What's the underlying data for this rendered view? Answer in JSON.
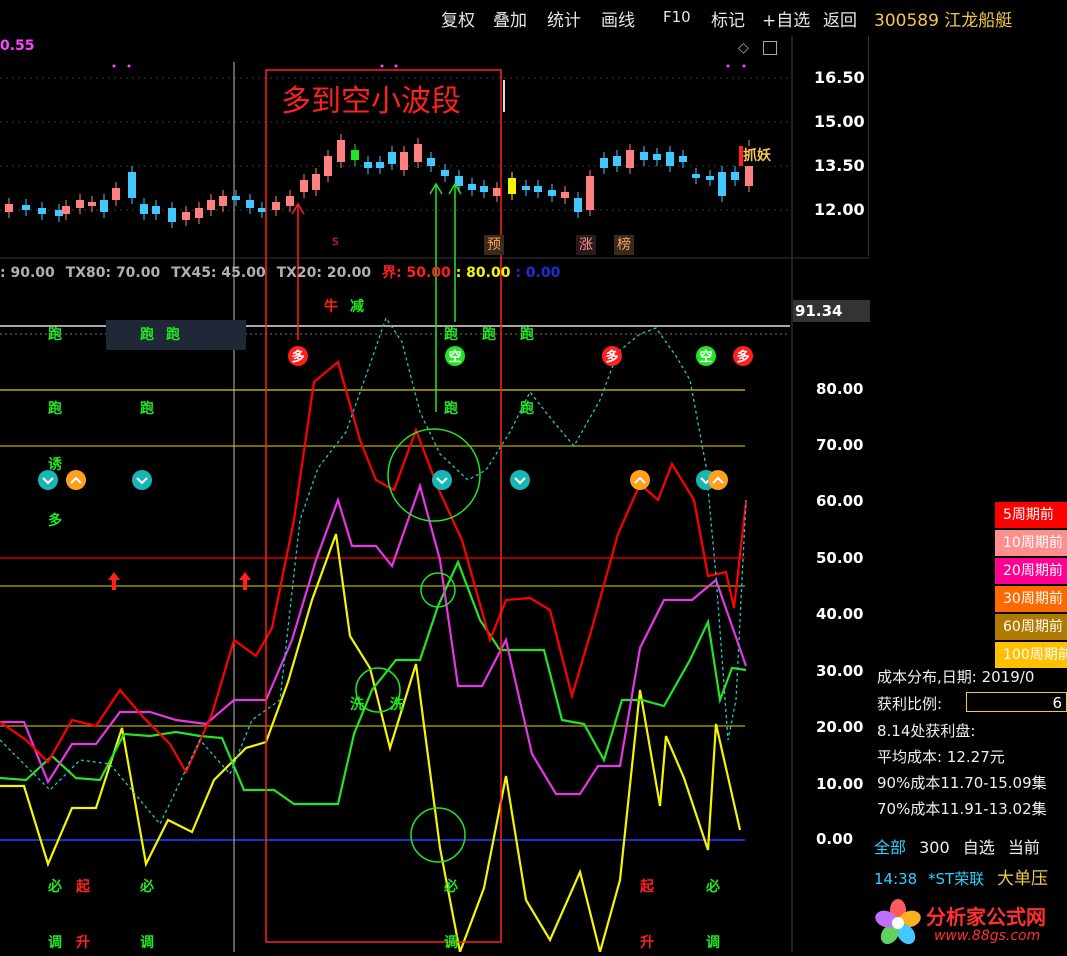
{
  "menu": [
    "复权",
    "叠加",
    "统计",
    "画线",
    "F10",
    "标记",
    "+自选",
    "返回"
  ],
  "stock_title": "300589 江龙船艇",
  "corner_value": "0.55",
  "price_axis": [
    "16.50",
    "15.00",
    "13.50",
    "12.00"
  ],
  "indicator_axis": [
    "80.00",
    "70.00",
    "60.00",
    "50.00",
    "40.00",
    "30.00",
    "20.00",
    "10.00",
    "0.00"
  ],
  "current_value": "91.34",
  "annotation_title": "多到空小波段",
  "price_tags": {
    "zhuayao": "抓妖",
    "yu": "预",
    "zhang": "涨",
    "bang": "榜",
    "s": "s"
  },
  "indicator_header": {
    "tx90": ": 90.00",
    "tx80": "TX80: 70.00",
    "tx45": "TX45: 45.00",
    "tx20": "TX20: 20.00",
    "jie": "界: 50.00",
    "v80": ": 80.00",
    "v0": ": 0.00"
  },
  "signals": {
    "pao": "跑",
    "duo": "多",
    "kong": "空",
    "you": "诱",
    "xi": "洗",
    "niu": "牛",
    "jian": "减",
    "bi": "必",
    "qi": "起",
    "tiao": "调",
    "sheng": "升"
  },
  "legend": [
    {
      "label": "5周期前",
      "color": "#ff0000"
    },
    {
      "label": "10周期前",
      "color": "#ff8f8f"
    },
    {
      "label": "20周期前",
      "color": "#ff0090"
    },
    {
      "label": "30周期前",
      "color": "#ff6a00"
    },
    {
      "label": "60周期前",
      "color": "#b07a00"
    },
    {
      "label": "100周期前",
      "color": "#ffc000"
    }
  ],
  "cost_info": {
    "title": "成本分布,日期: 2019/0",
    "profit_label": "获利比例:",
    "profit_value": "6",
    "profit_at": "8.14处获利盘:",
    "avg_cost": "平均成本: 12.27元",
    "cost90": "90%成本11.70-15.09集",
    "cost70": "70%成本11.91-13.02集"
  },
  "tabs": [
    "全部",
    "300",
    "自选",
    "当前"
  ],
  "ticker": {
    "time": "14:38",
    "name": "*ST荣联",
    "event": "大单压"
  },
  "logo": {
    "name": "分析家公式网",
    "url": "www.88gs.com"
  }
}
